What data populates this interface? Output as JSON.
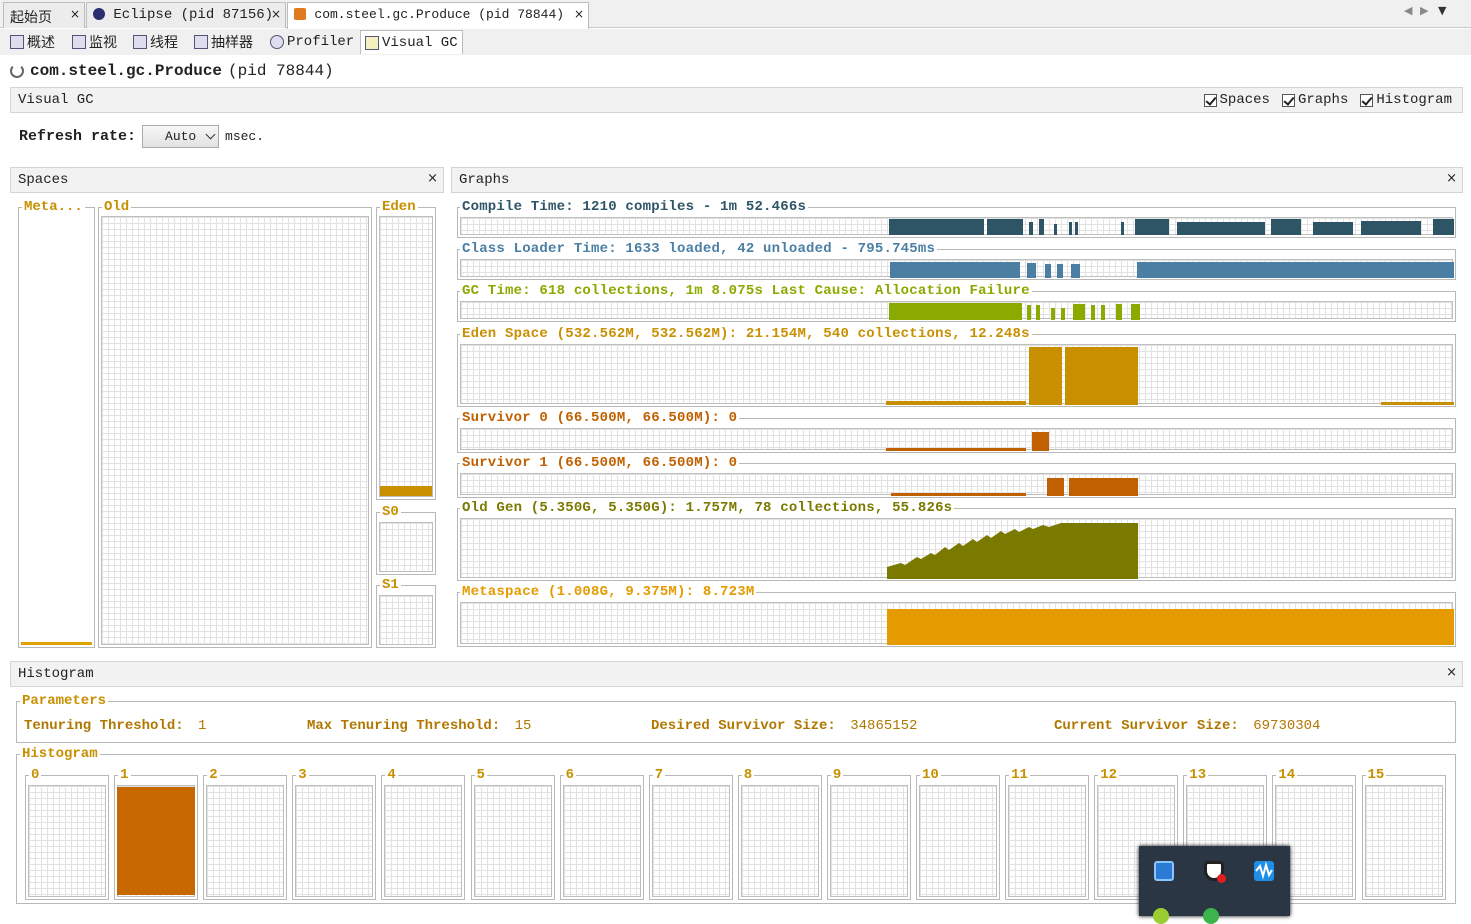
{
  "doc_tabs": [
    {
      "label": "起始页",
      "close": "×"
    },
    {
      "label": "Eclipse (pid 87156)",
      "close": "×",
      "icon": "eclipse-icon"
    },
    {
      "label": "com.steel.gc.Produce (pid 78844)",
      "close": "×",
      "icon": "java-cup-icon"
    }
  ],
  "sub_tabs": [
    {
      "label": "概述",
      "icon": "overview-icon"
    },
    {
      "label": "监视",
      "icon": "monitor-icon"
    },
    {
      "label": "线程",
      "icon": "threads-icon"
    },
    {
      "label": "抽样器",
      "icon": "sampler-icon"
    },
    {
      "label": "Profiler",
      "icon": "profiler-icon"
    },
    {
      "label": "Visual GC",
      "icon": "visualgc-icon"
    }
  ],
  "app": {
    "name": "com.steel.gc.Produce",
    "pid": "(pid 78844)"
  },
  "visualgc": {
    "title": "Visual GC",
    "toggles": [
      {
        "label": "Spaces",
        "checked": true
      },
      {
        "label": "Graphs",
        "checked": true
      },
      {
        "label": "Histogram",
        "checked": true
      }
    ],
    "refresh_label": "Refresh rate:",
    "refresh_value": "Auto",
    "refresh_unit": "msec."
  },
  "spaces": {
    "title": "Spaces",
    "close": "×",
    "metaspace": {
      "label": "Meta...",
      "fill": 0.02
    },
    "old": {
      "label": "Old",
      "fill": 0.0
    },
    "eden": {
      "label": "Eden",
      "fill": 0.04
    },
    "s0": {
      "label": "S0",
      "fill": 0.0
    },
    "s1": {
      "label": "S1",
      "fill": 0.0
    }
  },
  "graphs": {
    "title": "Graphs",
    "close": "×",
    "rows": [
      {
        "label": "Compile Time: 1210 compiles - 1m 52.466s",
        "color": "#2e5566"
      },
      {
        "label": "Class Loader Time: 1633 loaded, 42 unloaded - 795.745ms",
        "color": "#4a7fa3"
      },
      {
        "label": "GC Time: 618 collections, 1m 8.075s  Last Cause: Allocation Failure",
        "color": "#8aaa00"
      },
      {
        "label": "Eden Space (532.562M, 532.562M): 21.154M, 540 collections, 12.248s",
        "color": "#c89000"
      },
      {
        "label": "Survivor 0 (66.500M, 66.500M): 0",
        "color": "#c06000"
      },
      {
        "label": "Survivor 1 (66.500M, 66.500M): 0",
        "color": "#c06000"
      },
      {
        "label": "Old Gen (5.350G, 5.350G): 1.757M, 78 collections, 55.826s",
        "color": "#7a7a00"
      },
      {
        "label": "Metaspace (1.008G, 9.375M): 8.723M",
        "color": "#e59a00"
      }
    ]
  },
  "histogram": {
    "title": "Histogram",
    "close": "×",
    "params_title": "Parameters",
    "params": [
      {
        "label": "Tenuring Threshold:",
        "value": "1"
      },
      {
        "label": "Max Tenuring Threshold:",
        "value": "15"
      },
      {
        "label": "Desired Survivor Size:",
        "value": "34865152"
      },
      {
        "label": "Current Survivor Size:",
        "value": "69730304"
      }
    ],
    "hist_title": "Histogram",
    "buckets": [
      {
        "label": "0",
        "fill": 0
      },
      {
        "label": "1",
        "fill": 1
      },
      {
        "label": "2",
        "fill": 0
      },
      {
        "label": "3",
        "fill": 0
      },
      {
        "label": "4",
        "fill": 0
      },
      {
        "label": "5",
        "fill": 0
      },
      {
        "label": "6",
        "fill": 0
      },
      {
        "label": "7",
        "fill": 0
      },
      {
        "label": "8",
        "fill": 0
      },
      {
        "label": "9",
        "fill": 0
      },
      {
        "label": "10",
        "fill": 0
      },
      {
        "label": "11",
        "fill": 0
      },
      {
        "label": "12",
        "fill": 0
      },
      {
        "label": "13",
        "fill": 0
      },
      {
        "label": "14",
        "fill": 0
      },
      {
        "label": "15",
        "fill": 0
      }
    ],
    "bar_color": "#c86800"
  },
  "tray": {
    "icons": [
      "window-manager-icon",
      "shield-icon",
      "audio-wave-icon"
    ]
  }
}
